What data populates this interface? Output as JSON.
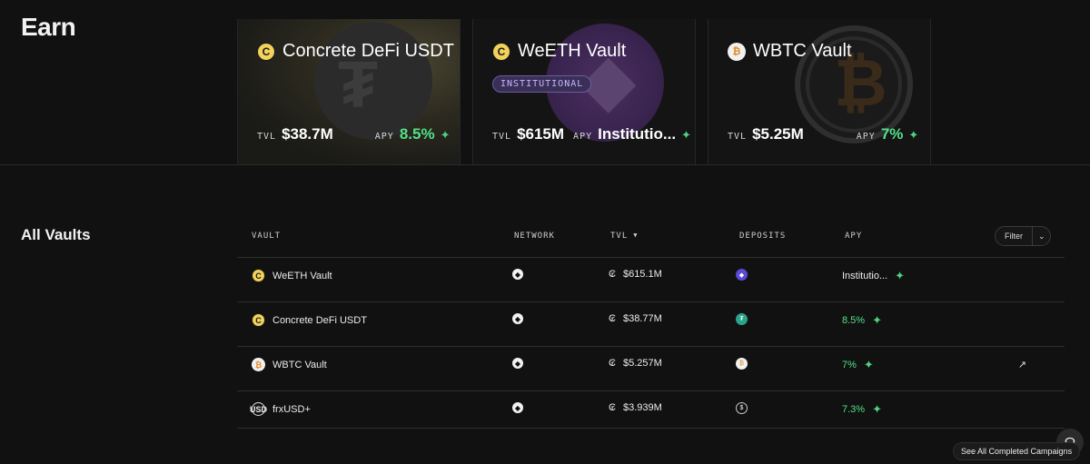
{
  "header": {
    "title": "Earn"
  },
  "featured": [
    {
      "name": "Concrete DeFi USDT",
      "icon": "concrete-coin-icon",
      "tvl_label": "TVL",
      "tvl": "$38.7M",
      "apy_label": "APY",
      "apy": "8.5%",
      "apy_color": "#54e08a"
    },
    {
      "name": "WeETH Vault",
      "icon": "concrete-coin-icon",
      "badge": "INSTITUTIONAL",
      "tvl_label": "TVL",
      "tvl": "$615M",
      "apy_label": "APY",
      "apy": "Institutio..."
    },
    {
      "name": "WBTC Vault",
      "icon": "wbtc-coin-icon",
      "tvl_label": "TVL",
      "tvl": "$5.25M",
      "apy_label": "APY",
      "apy": "7%",
      "apy_color": "#54e08a"
    }
  ],
  "vaults": {
    "title": "All Vaults",
    "columns": {
      "vault": "VAULT",
      "network": "NETWORK",
      "tvl": "TVL",
      "deposits": "DEPOSITS",
      "apy": "APY"
    },
    "filter": {
      "label": "Filter"
    },
    "rows": [
      {
        "name": "WeETH Vault",
        "tvl": "$615.1M",
        "apy": "Institutio..."
      },
      {
        "name": "Concrete DeFi USDT",
        "tvl": "$38.77M",
        "apy": "8.5%"
      },
      {
        "name": "WBTC Vault",
        "tvl": "$5.257M",
        "apy": "7%"
      },
      {
        "name": "frxUSD+",
        "tvl": "$3.939M",
        "apy": "7.3%"
      }
    ]
  },
  "footer": {
    "campaigns_label": "See All Completed Campaigns"
  }
}
